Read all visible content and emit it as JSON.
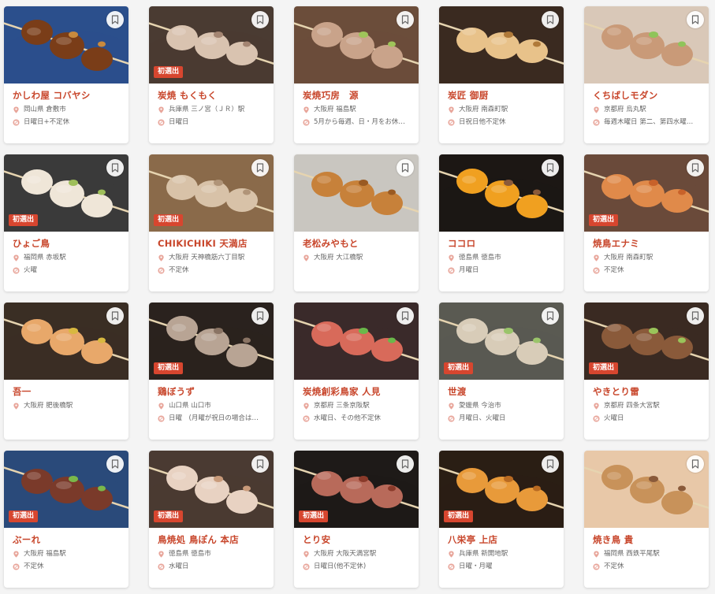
{
  "badge_label": "初選出",
  "colors": {
    "accent": "#c8462b",
    "badge": "#d7462f",
    "pin": "#e8a59a"
  },
  "icons": {
    "location": "map-pin-icon",
    "holiday": "closed-day-icon",
    "bookmark": "bookmark-icon"
  },
  "restaurants": [
    {
      "name": "かしわ屋 コバヤシ",
      "location": "岡山県 倉敷市",
      "holiday": "日曜日+不定休",
      "badge": false,
      "palette": [
        "#2b4f8c",
        "#7a3d18",
        "#c98a3d"
      ]
    },
    {
      "name": "炭焼 もくもく",
      "location": "兵庫県 三ノ宮（ＪＲ）駅",
      "holiday": "日曜日",
      "badge": true,
      "palette": [
        "#4a3b32",
        "#d9c3b0",
        "#a48572"
      ]
    },
    {
      "name": "炭焼巧房　源",
      "location": "大阪府 福島駅",
      "holiday": "5月から毎週、日・月をお休…",
      "badge": false,
      "palette": [
        "#6b4d3a",
        "#c9a38a",
        "#9fc45a"
      ]
    },
    {
      "name": "炭匠 御厨",
      "location": "大阪府 南森町駅",
      "holiday": "日祝日他不定休",
      "badge": false,
      "palette": [
        "#3a2a20",
        "#e8c28a",
        "#b07a3a"
      ]
    },
    {
      "name": "くちばしモダン",
      "location": "京都府 烏丸駅",
      "holiday": "毎週木曜日 第二、第四水曜…",
      "badge": false,
      "palette": [
        "#d9c8b8",
        "#c99a78",
        "#8fc45a"
      ]
    },
    {
      "name": "ひょご鳥",
      "location": "福岡県 赤坂駅",
      "holiday": "火曜",
      "badge": true,
      "palette": [
        "#3a3a3a",
        "#efe6d8",
        "#9fbf5a"
      ]
    },
    {
      "name": "CHIKICHIKI 天満店",
      "location": "大阪府 天神橋筋六丁目駅",
      "holiday": "不定休",
      "badge": true,
      "palette": [
        "#8a6a4a",
        "#d8c2a8",
        "#b09478"
      ]
    },
    {
      "name": "老松みやもと",
      "location": "大阪府 大江橋駅",
      "holiday": "",
      "badge": false,
      "palette": [
        "#c9c6c0",
        "#c7813a",
        "#9a5a22"
      ]
    },
    {
      "name": "ココロ",
      "location": "徳島県 徳島市",
      "holiday": "月曜日",
      "badge": false,
      "palette": [
        "#1c1714",
        "#f0a020",
        "#8a5a3a"
      ]
    },
    {
      "name": "焼鳥エナミ",
      "location": "大阪府 南森町駅",
      "holiday": "不定休",
      "badge": true,
      "palette": [
        "#6a4a3a",
        "#e08a4a",
        "#c8622a"
      ]
    },
    {
      "name": "吾一",
      "location": "大阪府 肥後橋駅",
      "holiday": "",
      "badge": false,
      "palette": [
        "#3a2e24",
        "#e8a86a",
        "#d8b840"
      ]
    },
    {
      "name": "鶏ぼうず",
      "location": "山口県 山口市",
      "holiday": "日曜　(月曜が祝日の場合は…",
      "badge": true,
      "palette": [
        "#2a221e",
        "#b8a494",
        "#8a7464"
      ]
    },
    {
      "name": "炭焼創彩鳥家 人見",
      "location": "京都府 三条京阪駅",
      "holiday": "水曜日、その他不定休",
      "badge": false,
      "palette": [
        "#3a2a2a",
        "#d86a5a",
        "#6ab84a"
      ]
    },
    {
      "name": "世渡",
      "location": "愛媛県 今治市",
      "holiday": "月曜日、火曜日",
      "badge": true,
      "palette": [
        "#5a5a52",
        "#d8ccb8",
        "#9ac46a"
      ]
    },
    {
      "name": "やきとり雷",
      "location": "京都府 四条大宮駅",
      "holiday": "火曜日",
      "badge": true,
      "palette": [
        "#3a2a22",
        "#8a5a3a",
        "#9ac45a"
      ]
    },
    {
      "name": "ぶーれ",
      "location": "大阪府 福島駅",
      "holiday": "不定休",
      "badge": true,
      "palette": [
        "#2a4a7a",
        "#7a3a2a",
        "#7ab84a"
      ]
    },
    {
      "name": "鳥焼処 鳥ぽん 本店",
      "location": "徳島県 徳島市",
      "holiday": "水曜日",
      "badge": true,
      "palette": [
        "#4a3a32",
        "#e8d2c2",
        "#c89a7a"
      ]
    },
    {
      "name": "とり安",
      "location": "大阪府 大阪天満宮駅",
      "holiday": "日曜日(他不定休)",
      "badge": true,
      "palette": [
        "#1e1a18",
        "#b86a5a",
        "#8a3a2a"
      ]
    },
    {
      "name": "八栄亭 上店",
      "location": "兵庫県 新開地駅",
      "holiday": "日曜・月曜",
      "badge": true,
      "palette": [
        "#2a1e14",
        "#e89a3a",
        "#b86a22"
      ]
    },
    {
      "name": "焼き鳥 貴",
      "location": "福岡県 西鉄平尾駅",
      "holiday": "不定休",
      "badge": false,
      "palette": [
        "#e8c8a8",
        "#c8925a",
        "#8a5a3a"
      ]
    }
  ]
}
